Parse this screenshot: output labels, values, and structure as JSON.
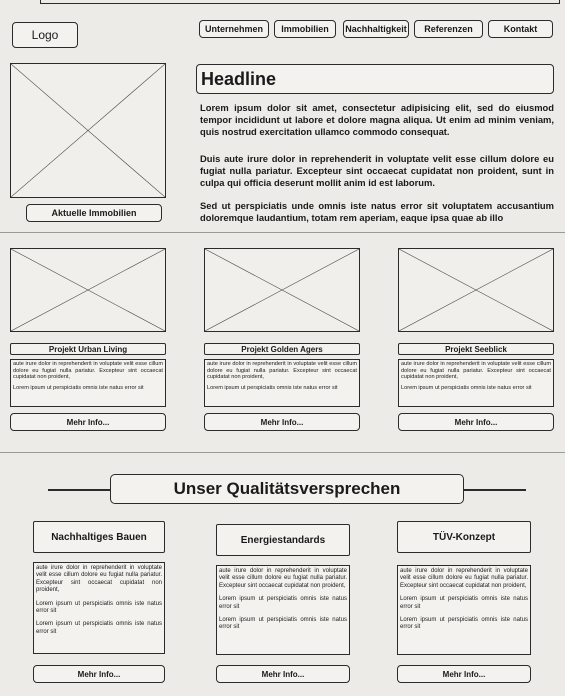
{
  "header": {
    "logo_label": "Logo",
    "nav": [
      "Unternehmen",
      "Immobilien",
      "Nachhaltigkeit",
      "Referenzen",
      "Kontakt"
    ]
  },
  "hero": {
    "headline": "Headline",
    "paragraphs": [
      "Lorem ipsum dolor sit amet, consectetur adipisicing elit, sed do eiusmod tempor incididunt ut labore et dolore magna aliqua. Ut enim ad minim veniam, quis nostrud exercitation ullamco commodo consequat.",
      "Duis aute irure dolor in reprehenderit in voluptate velit esse cillum dolore eu fugiat nulla pariatur. Excepteur sint occaecat cupidatat non proident, sunt in culpa qui officia deserunt mollit anim id est laborum.",
      "Sed ut perspiciatis unde omnis iste natus error sit voluptatem accusantium doloremque laudantium, totam rem aperiam, eaque ipsa quae ab illo"
    ],
    "button_label": "Aktuelle Immobilien"
  },
  "projects": [
    {
      "title": "Projekt Urban Living",
      "text1": "aute irure dolor in reprehenderit in voluptate velit esse cillum dolore eu fugiat nulla pariatur. Excepteur sint occaecat cupidatat non proident,",
      "text2": "Lorem ipsum ut perspiciatis omnis iste natus error sit",
      "more": "Mehr Info..."
    },
    {
      "title": "Projekt Golden Agers",
      "text1": "aute irure dolor in reprehenderit in voluptate velit esse cillum dolore eu fugiat nulla pariatur. Excepteur sint occaecat cupidatat non proident,",
      "text2": "Lorem ipsum ut perspiciatis omnis iste natus error sit",
      "more": "Mehr Info..."
    },
    {
      "title": "Projekt Seeblick",
      "text1": "aute irure dolor in reprehenderit in voluptate velit esse cillum dolore eu fugiat nulla pariatur. Excepteur sint occaecat cupidatat non proident,",
      "text2": "Lorem ipsum ut perspiciatis omnis iste natus error sit",
      "more": "Mehr Info..."
    }
  ],
  "quality": {
    "heading": "Unser Qualitätsversprechen",
    "columns": [
      {
        "title": "Nachhaltiges Bauen",
        "text1": "aute irure dolor in reprehenderit in voluptate velit esse cillum dolore eu fugiat nulla pariatur. Excepteur sint occaecat cupidatat non proident,",
        "text2": "Lorem ipsum ut perspiciatis omnis iste natus error sit",
        "text3": "Lorem ipsum ut perspiciatis omnis iste natus error sit",
        "more": "Mehr Info..."
      },
      {
        "title": "Energiestandards",
        "text1": "aute irure dolor in reprehenderit in voluptate velit esse cillum dolore eu fugiat nulla pariatur. Excepteur sint occaecat cupidatat non proident,",
        "text2": "Lorem ipsum ut perspiciatis omnis iste natus error sit",
        "text3": "Lorem ipsum ut perspiciatis omnis iste natus error sit",
        "more": "Mehr Info..."
      },
      {
        "title": "TÜV-Konzept",
        "text1": "aute irure dolor in reprehenderit in voluptate velit esse cillum dolore eu fugiat nulla pariatur. Excepteur sint occaecat cupidatat non proident,",
        "text2": "Lorem ipsum ut perspiciatis omnis iste natus error sit",
        "text3": "Lorem ipsum ut perspiciatis omnis iste natus error sit",
        "more": "Mehr Info..."
      }
    ]
  }
}
